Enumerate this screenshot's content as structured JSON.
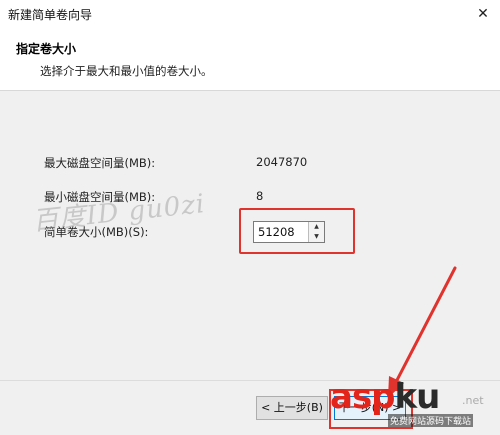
{
  "window": {
    "title": "新建简单卷向导",
    "close_glyph": "✕"
  },
  "header": {
    "title": "指定卷大小",
    "description": "选择介于最大和最小值的卷大小。"
  },
  "fields": {
    "max_label": "最大磁盘空间量(MB):",
    "max_value": "2047870",
    "min_label": "最小磁盘空间量(MB):",
    "min_value": "8",
    "size_label": "简单卷大小(MB)(S):",
    "size_value": "51208"
  },
  "spinner": {
    "up_glyph": "▲",
    "down_glyph": "▼"
  },
  "buttons": {
    "back_label": "< 上一步(B)",
    "next_label": "下一步(N) >"
  },
  "watermarks": {
    "baidu": "百度ID gu0zi",
    "aspku_a": "asp",
    "aspku_b": "ku",
    "aspku_sub": "免费网站源码下载站",
    "aspku_net": ".net"
  },
  "annotation_colors": {
    "highlight": "#e0332e",
    "brand_red": "#e3241b"
  }
}
